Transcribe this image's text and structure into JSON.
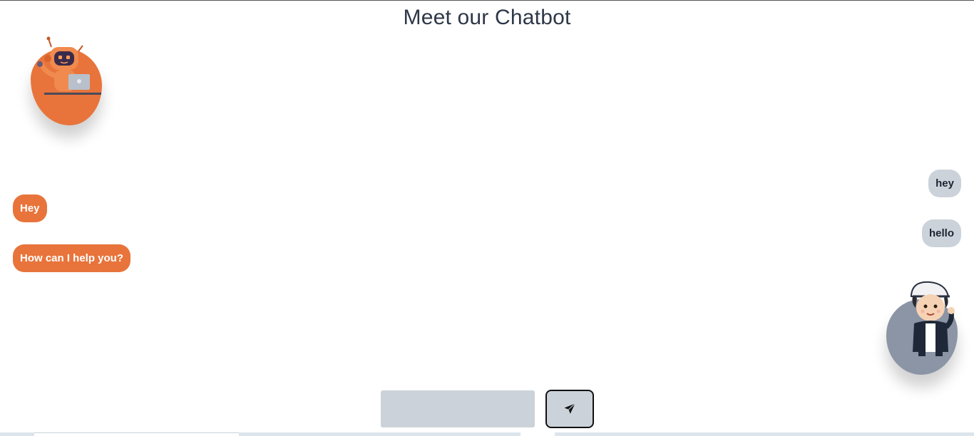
{
  "header": {
    "title": "Meet our Chatbot"
  },
  "avatars": {
    "bot": {
      "icon": "robot-icon",
      "color": "#e8743b"
    },
    "user": {
      "icon": "boy-avatar-icon",
      "color": "#8b95a5"
    }
  },
  "messages": [
    {
      "sender": "user",
      "text": "hey"
    },
    {
      "sender": "bot",
      "text": "Hey"
    },
    {
      "sender": "user",
      "text": "hello"
    },
    {
      "sender": "bot",
      "text": "How can I help you?"
    }
  ],
  "composer": {
    "input_value": "",
    "input_placeholder": "",
    "send_icon": "send-icon"
  },
  "colors": {
    "bot_bubble": "#e8743b",
    "user_bubble": "#cbd2da",
    "title": "#2d3748"
  }
}
